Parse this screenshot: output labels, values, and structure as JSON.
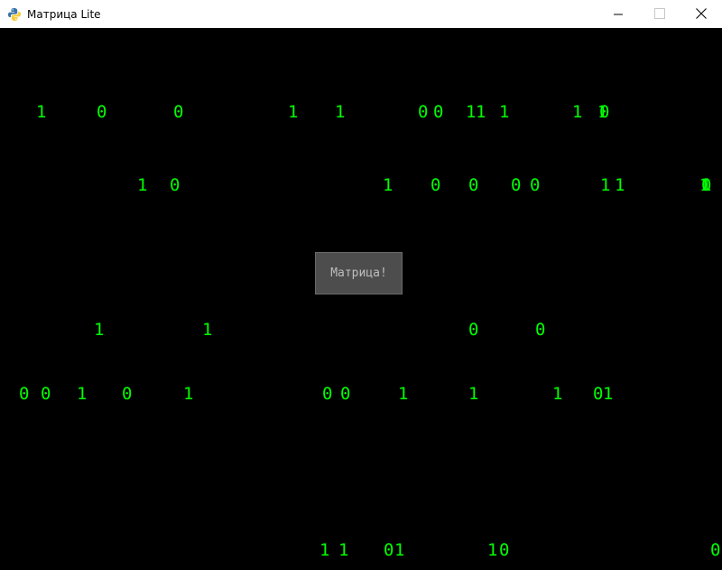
{
  "window": {
    "title": "Матрица Lite",
    "icon": "python-icon",
    "controls": [
      "minimize-icon",
      "maximize-icon",
      "close-icon"
    ]
  },
  "colors": {
    "glyph": "#00ff00",
    "canvas_background": "#000000",
    "button_background": "#4d4d4d",
    "button_text": "#bdbdbd"
  },
  "button": {
    "label": "Матрица!"
  },
  "rows": [
    {
      "glyphs": [
        "1",
        "0",
        "0",
        "1",
        "1",
        "0",
        "0",
        "1",
        "1",
        "1",
        "1",
        "1",
        "0"
      ]
    },
    {
      "glyphs": [
        "1",
        "0",
        "1",
        "0",
        "0",
        "0",
        "0",
        "1",
        "1",
        "1",
        "0",
        "1"
      ]
    },
    {
      "glyphs": [
        "1",
        "1",
        "0",
        "0"
      ]
    },
    {
      "glyphs": [
        "0",
        "0",
        "1",
        "0",
        "1",
        "0",
        "0",
        "1",
        "1",
        "1",
        "0",
        "1"
      ]
    },
    {
      "glyphs": [
        "1",
        "1",
        "0",
        "1",
        "1",
        "0",
        "0"
      ]
    }
  ]
}
